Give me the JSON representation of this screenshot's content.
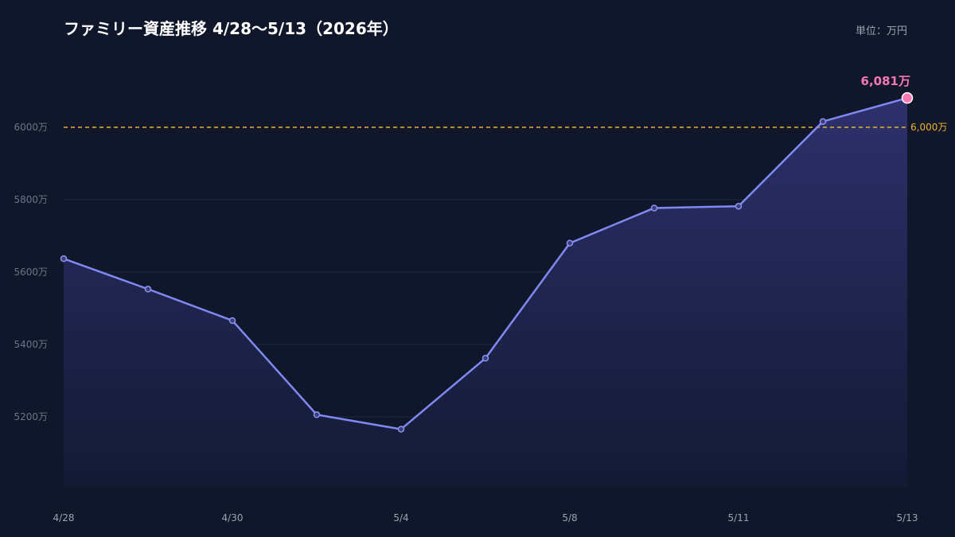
{
  "title": "ファミリー資産推移 4/28〜5/13（2026年）",
  "unit_label": "単位：万円",
  "chart_data": {
    "type": "area",
    "title": "ファミリー資産推移 4/28〜5/13（2026年）",
    "xlabel": "",
    "ylabel": "",
    "x": [
      "4/28",
      "4/29",
      "4/30",
      "5/1",
      "5/4",
      "5/5",
      "5/8",
      "5/9",
      "5/11",
      "5/12",
      "5/13"
    ],
    "x_tick_labels": [
      "4/28",
      "4/30",
      "5/4",
      "5/8",
      "5/11",
      "5/13"
    ],
    "values": [
      5637,
      5553,
      5466,
      5206,
      5166,
      5362,
      5680,
      5777,
      5782,
      6016,
      6081
    ],
    "y_ticks": [
      5200,
      5400,
      5600,
      5800,
      6000
    ],
    "y_tick_suffix": "万",
    "ylim": [
      5000,
      6140
    ],
    "reference_line": {
      "value": 6000,
      "label": "6,000万"
    },
    "last_point_label": "6,081万",
    "colors": {
      "line": "#8088f2",
      "fill_top": "#2f3270",
      "fill_bottom": "#141a35",
      "reference": "#f0b429",
      "highlight": "#f678b4"
    },
    "grid": true
  }
}
